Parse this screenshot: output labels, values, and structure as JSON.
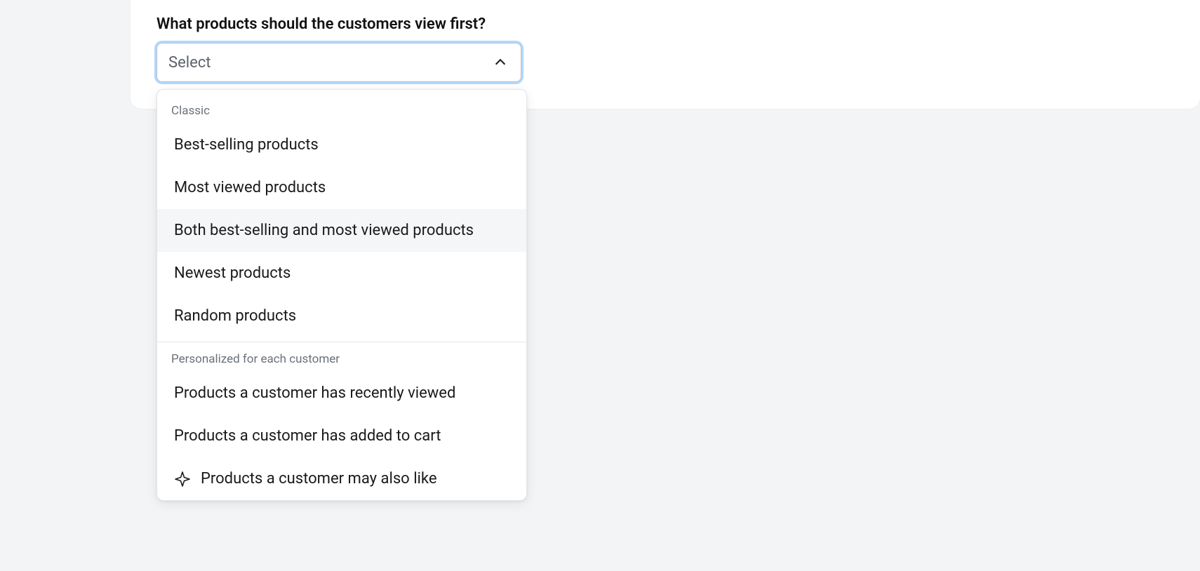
{
  "form": {
    "label": "What products should the customers view first?",
    "select": {
      "placeholder": "Select"
    }
  },
  "dropdown": {
    "groups": [
      {
        "header": "Classic",
        "options": [
          {
            "label": "Best-selling products",
            "hovered": false,
            "icon": null
          },
          {
            "label": "Most viewed products",
            "hovered": false,
            "icon": null
          },
          {
            "label": "Both best-selling and most viewed products",
            "hovered": true,
            "icon": null
          },
          {
            "label": "Newest products",
            "hovered": false,
            "icon": null
          },
          {
            "label": "Random products",
            "hovered": false,
            "icon": null
          }
        ]
      },
      {
        "header": "Personalized for each customer",
        "options": [
          {
            "label": "Products a customer has recently viewed",
            "hovered": false,
            "icon": null
          },
          {
            "label": "Products a customer has added to cart",
            "hovered": false,
            "icon": null
          },
          {
            "label": "Products a customer may also like",
            "hovered": false,
            "icon": "sparkle"
          }
        ]
      }
    ]
  }
}
